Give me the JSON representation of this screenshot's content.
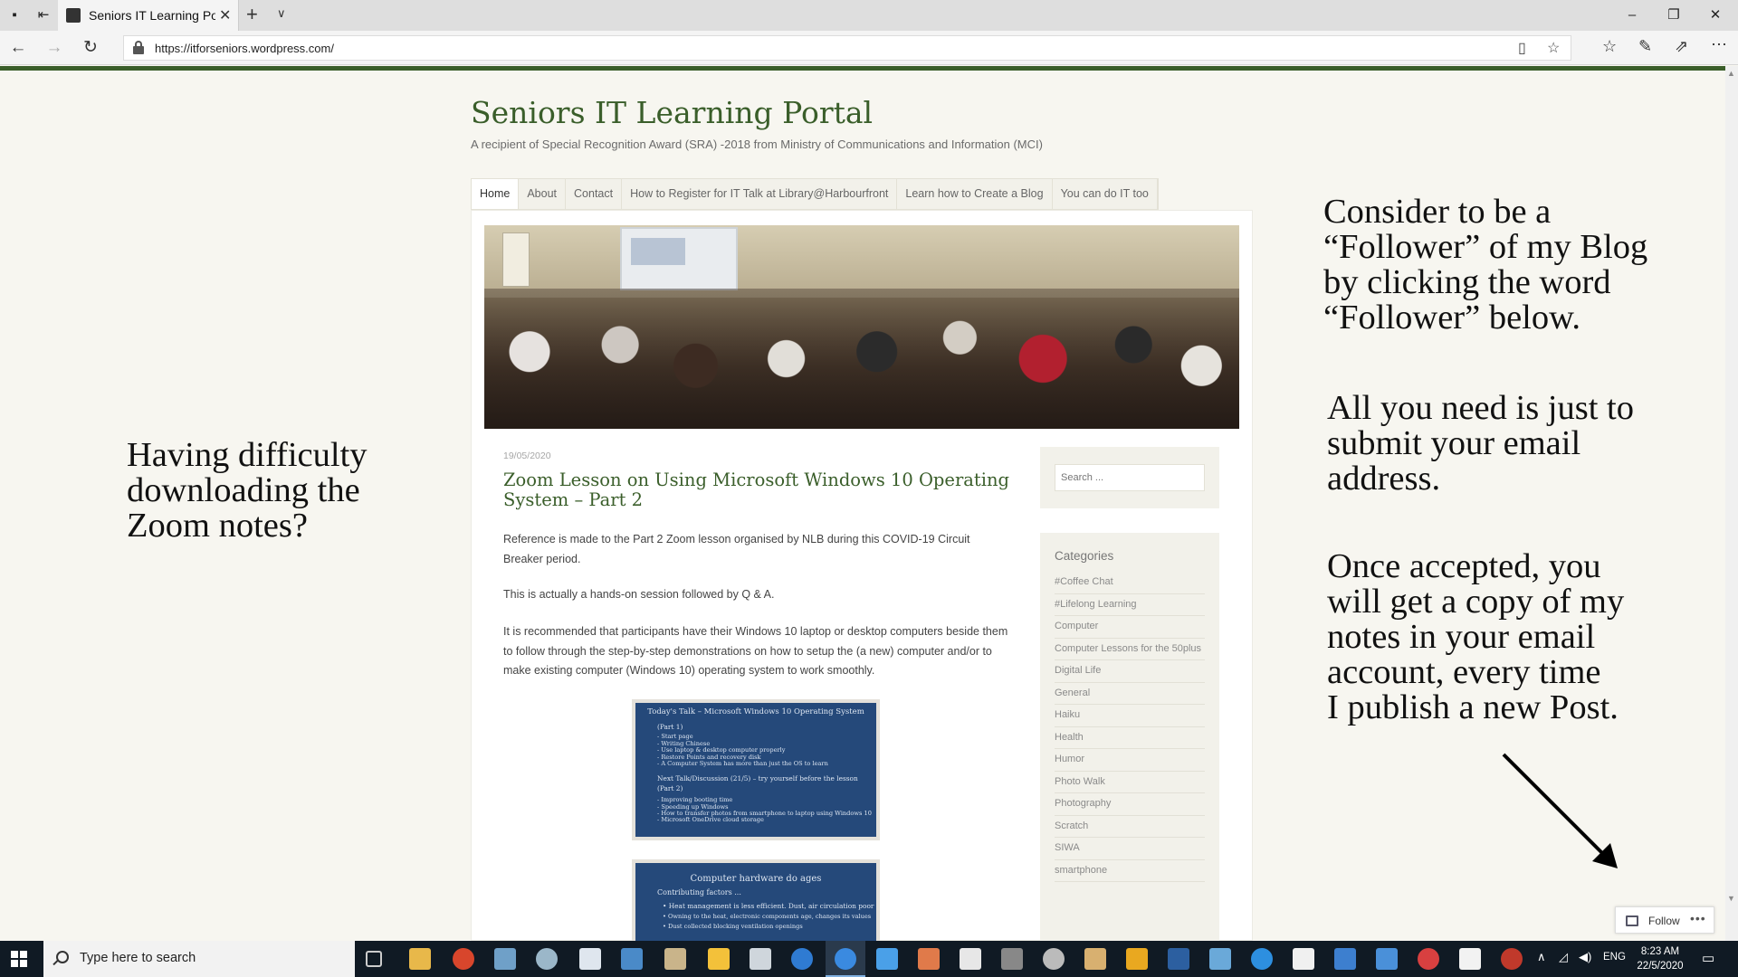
{
  "browser": {
    "tab_title": "Seniors IT Learning Port",
    "url": "https://itforseniors.wordpress.com/"
  },
  "site": {
    "title": "Seniors IT Learning Portal",
    "tagline": "A recipient of Special Recognition Award (SRA) -2018 from Ministry of Communications and Information (MCI)",
    "menu": [
      "Home",
      "About",
      "Contact",
      "How to Register for IT Talk at Library@Harbourfront",
      "Learn how to Create a Blog",
      "You can do IT too"
    ]
  },
  "post": {
    "date": "19/05/2020",
    "title": "Zoom Lesson on Using Microsoft Windows 10 Operating System – Part 2",
    "paragraphs": [
      "Reference is made to the Part 2 Zoom lesson organised by NLB during this COVID-19 Circuit Breaker period.",
      "This is actually a hands-on session followed by Q & A.",
      "It is recommended that participants have their Windows 10 laptop or desktop computers beside them to follow through the step-by-step demonstrations on how to setup the (a new) computer and/or to make existing computer (Windows 10) operating system to work smoothly."
    ],
    "slide1": {
      "heading": "Today's Talk – Microsoft Windows 10 Operating System",
      "part1": "(Part 1)",
      "part1_items": [
        "- Start page",
        "- Writing Chinese",
        "- Use laptop & desktop computer properly",
        "- Restore Points and recovery disk",
        "- A Computer System has more than just the OS to learn"
      ],
      "next": "Next Talk/Discussion (21/5) – try yourself before the lesson",
      "part2": "(Part 2)",
      "part2_items": [
        "- Improving booting time",
        "- Speeding up Windows",
        "- How to transfer photos from smartphone to laptop using Windows 10",
        "- Microsoft OneDrive cloud storage"
      ]
    },
    "slide2": {
      "heading": "Computer hardware do ages",
      "sub": "Contributing factors ...",
      "items": [
        "Heat management is less efficient. Dust, air circulation poor",
        "Owning to the heat, electronic components age, changes its values",
        "Dust collected blocking ventilation openings"
      ]
    }
  },
  "sidebar": {
    "search_placeholder": "Search ...",
    "categories_heading": "Categories",
    "categories": [
      "#Coffee Chat",
      "#Lifelong Learning",
      "Computer",
      "Computer Lessons for the 50plus",
      "Digital Life",
      "General",
      "Haiku",
      "Health",
      "Humor",
      "Photo Walk",
      "Photography",
      "Scratch",
      "SIWA",
      "smartphone"
    ]
  },
  "annotations": {
    "left_note": [
      "Having difficulty",
      "downloading the",
      "Zoom notes?"
    ],
    "right_note_1": [
      "Consider to be a",
      "“Follower” of my Blog",
      "by clicking the word",
      "“Follower” below."
    ],
    "right_note_2": [
      "All you need is just to",
      "submit your email",
      "address."
    ],
    "right_note_3": [
      "Once accepted, you",
      "will get a copy of my",
      "notes in your email",
      "account, every time",
      "I publish a new Post."
    ]
  },
  "follow_widget": {
    "label": "Follow",
    "more": "•••"
  },
  "taskbar": {
    "search_placeholder": "Type here to search",
    "language": "ENG",
    "time": "8:23 AM",
    "date": "22/5/2020"
  },
  "colors": {
    "site_green": "#3a5e2a",
    "taskbar": "#101a24",
    "slide_blue": "#25497a"
  }
}
